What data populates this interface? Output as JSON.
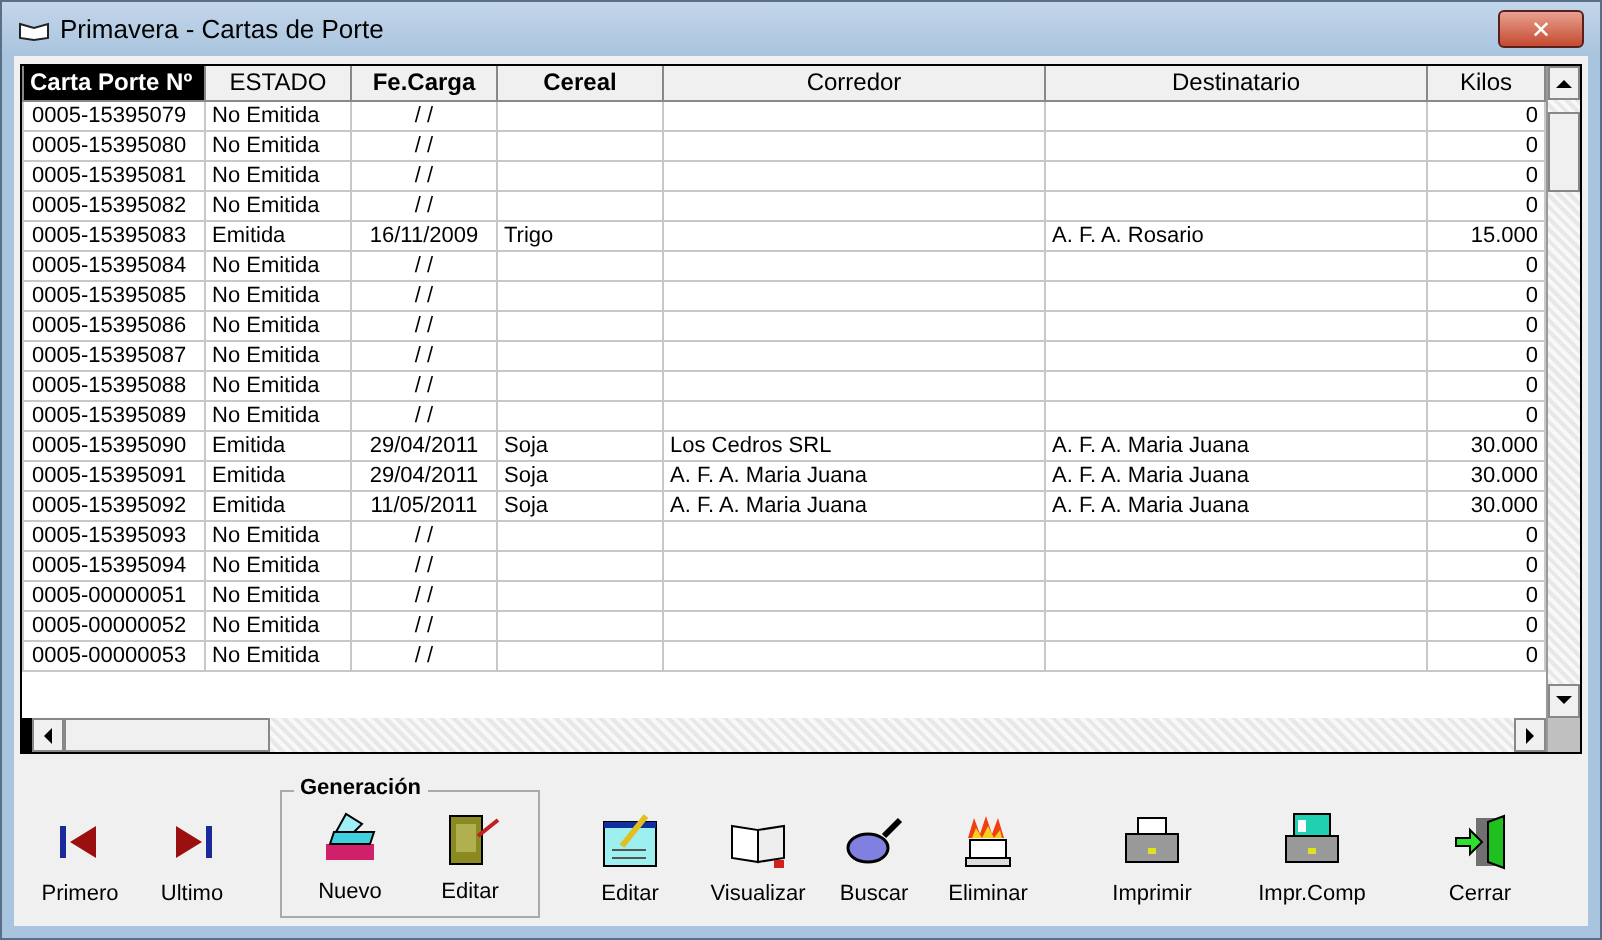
{
  "window": {
    "title": "Primavera - Cartas de Porte",
    "close": "✕"
  },
  "table": {
    "columns": [
      {
        "label": "Carta Porte Nº",
        "selected": true
      },
      {
        "label": "ESTADO",
        "selected": false
      },
      {
        "label": "Fe.Carga",
        "selected": false
      },
      {
        "label": "Cereal",
        "selected": false
      },
      {
        "label": "Corredor",
        "selected": false
      },
      {
        "label": "Destinatario",
        "selected": false
      },
      {
        "label": "Kilos",
        "selected": false
      }
    ],
    "rows": [
      [
        "0005-15395079",
        "No Emitida",
        "/ /",
        "",
        "",
        "",
        "0"
      ],
      [
        "0005-15395080",
        "No Emitida",
        "/ /",
        "",
        "",
        "",
        "0"
      ],
      [
        "0005-15395081",
        "No Emitida",
        "/ /",
        "",
        "",
        "",
        "0"
      ],
      [
        "0005-15395082",
        "No Emitida",
        "/ /",
        "",
        "",
        "",
        "0"
      ],
      [
        "0005-15395083",
        "Emitida",
        "16/11/2009",
        "Trigo",
        "",
        "A. F. A. Rosario",
        "15.000"
      ],
      [
        "0005-15395084",
        "No Emitida",
        "/ /",
        "",
        "",
        "",
        "0"
      ],
      [
        "0005-15395085",
        "No Emitida",
        "/ /",
        "",
        "",
        "",
        "0"
      ],
      [
        "0005-15395086",
        "No Emitida",
        "/ /",
        "",
        "",
        "",
        "0"
      ],
      [
        "0005-15395087",
        "No Emitida",
        "/ /",
        "",
        "",
        "",
        "0"
      ],
      [
        "0005-15395088",
        "No Emitida",
        "/ /",
        "",
        "",
        "",
        "0"
      ],
      [
        "0005-15395089",
        "No Emitida",
        "/ /",
        "",
        "",
        "",
        "0"
      ],
      [
        "0005-15395090",
        "Emitida",
        "29/04/2011",
        "Soja",
        "Los Cedros SRL",
        "A. F. A. Maria Juana",
        "30.000"
      ],
      [
        "0005-15395091",
        "Emitida",
        "29/04/2011",
        "Soja",
        "A. F. A. Maria Juana",
        "A. F. A. Maria Juana",
        "30.000"
      ],
      [
        "0005-15395092",
        "Emitida",
        "11/05/2011",
        "Soja",
        "A. F. A. Maria Juana",
        "A. F. A. Maria Juana",
        "30.000"
      ],
      [
        "0005-15395093",
        "No Emitida",
        "/ /",
        "",
        "",
        "",
        "0"
      ],
      [
        "0005-15395094",
        "No Emitida",
        "/ /",
        "",
        "",
        "",
        "0"
      ],
      [
        "0005-00000051",
        "No Emitida",
        "/ /",
        "",
        "",
        "",
        "0"
      ],
      [
        "0005-00000052",
        "No Emitida",
        "/ /",
        "",
        "",
        "",
        "0"
      ],
      [
        "0005-00000053",
        "No Emitida",
        "/ /",
        "",
        "",
        "",
        "0"
      ]
    ]
  },
  "toolbar": {
    "group_title": "Generación",
    "buttons": [
      {
        "label": "Primero"
      },
      {
        "label": "Ultimo"
      },
      {
        "label": "Nuevo"
      },
      {
        "label": "Editar"
      },
      {
        "label": "Editar"
      },
      {
        "label": "Visualizar"
      },
      {
        "label": "Buscar"
      },
      {
        "label": "Eliminar"
      },
      {
        "label": "Imprimir"
      },
      {
        "label": "Impr.Comp"
      },
      {
        "label": "Cerrar"
      }
    ]
  }
}
